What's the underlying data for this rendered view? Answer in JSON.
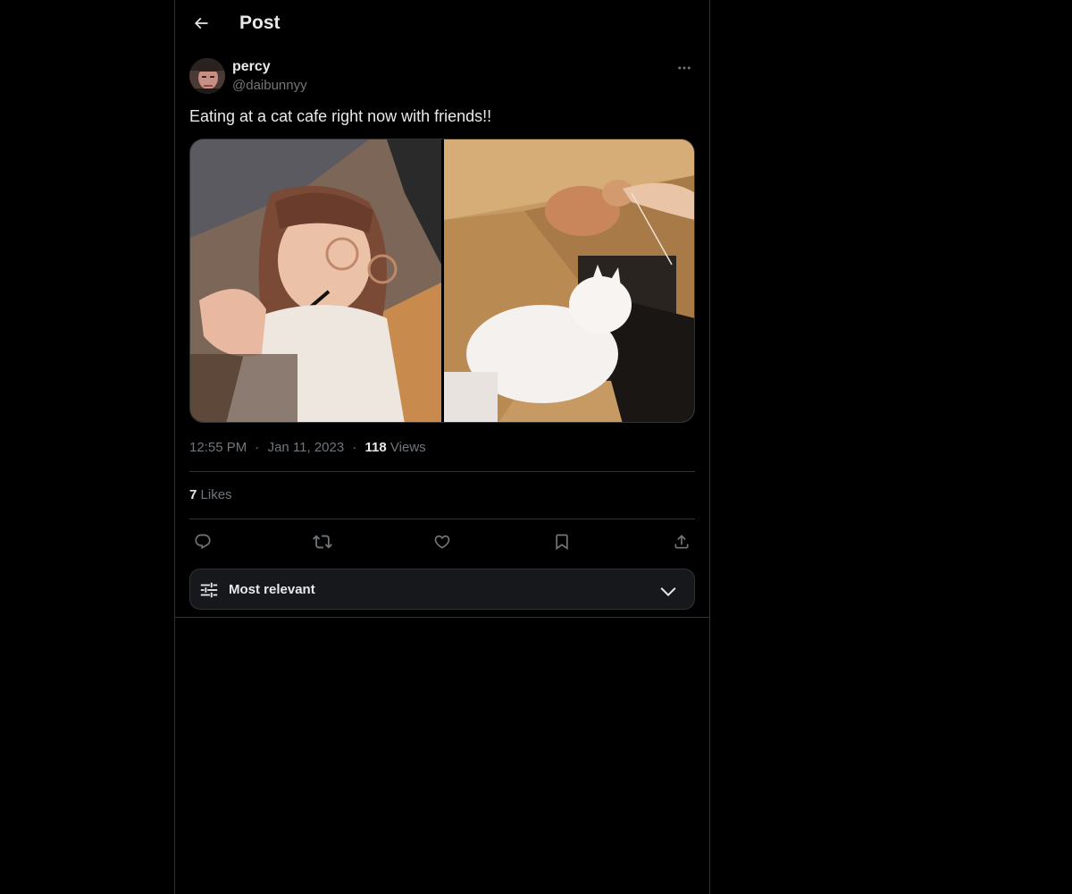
{
  "header": {
    "title": "Post",
    "back_icon": "arrow-left-icon"
  },
  "post": {
    "author": {
      "display_name": "percy",
      "handle": "@daibunnyy",
      "avatar_icon": "avatar"
    },
    "text": "Eating at a cat cafe right now with friends!!",
    "media": [
      {
        "description_icon": "photo-selfie"
      },
      {
        "description_icon": "photo-cats"
      }
    ],
    "time": "12:55 PM",
    "separator": "·",
    "date": "Jan 11, 2023",
    "views_count": "118",
    "views_label": "Views",
    "likes_count": "7",
    "likes_label": "Likes"
  },
  "actions": {
    "icons": [
      "reply-icon",
      "repost-icon",
      "like-icon",
      "bookmark-icon",
      "share-icon"
    ]
  },
  "sort": {
    "label": "Most relevant",
    "icon": "sliders-icon",
    "chevron": "chevron-down-icon"
  },
  "colors": {
    "background": "#000000",
    "text_primary": "#e7e9ea",
    "text_secondary": "#71767b",
    "border": "#2f3336",
    "sort_bg": "#16181c"
  }
}
